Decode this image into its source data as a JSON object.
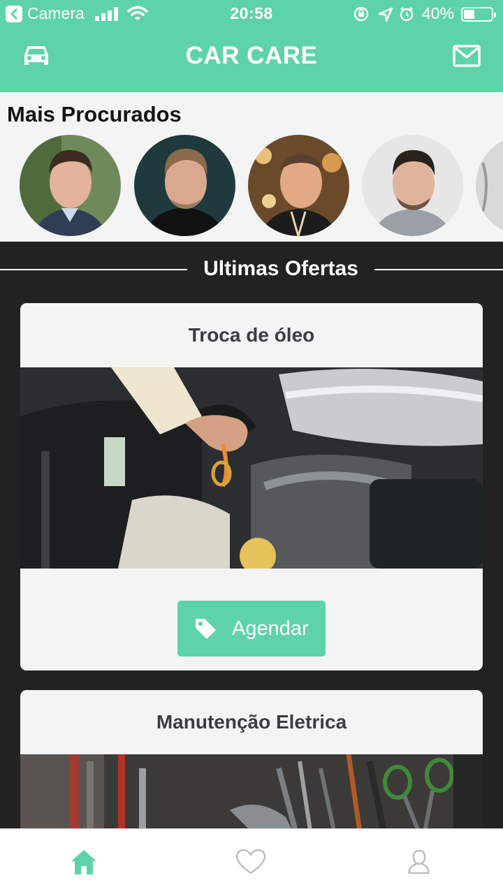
{
  "status_bar": {
    "back_app": "Camera",
    "time": "20:58",
    "battery": "40%",
    "battery_level": 0.4
  },
  "header": {
    "title": "CAR CARE",
    "left_icon": "car-icon",
    "right_icon": "mail-icon"
  },
  "popular": {
    "heading": "Mais Procurados",
    "avatars": [
      {
        "name": "avatar-1"
      },
      {
        "name": "avatar-2"
      },
      {
        "name": "avatar-3"
      },
      {
        "name": "avatar-4"
      },
      {
        "name": "avatar-5"
      }
    ]
  },
  "offers": {
    "heading": "Ultimas Ofertas",
    "items": [
      {
        "title": "Troca de óleo",
        "button_label": "Agendar",
        "button_icon": "tag-icon"
      },
      {
        "title": "Manutenção Eletrica"
      }
    ]
  },
  "tabbar": {
    "tabs": [
      {
        "icon": "home-icon",
        "active": true
      },
      {
        "icon": "heart-icon",
        "active": false
      },
      {
        "icon": "user-icon",
        "active": false
      }
    ]
  },
  "colors": {
    "accent": "#5fd3a8",
    "background": "#222222",
    "card": "#f4f4f4",
    "text_dark": "#3a3d42"
  }
}
